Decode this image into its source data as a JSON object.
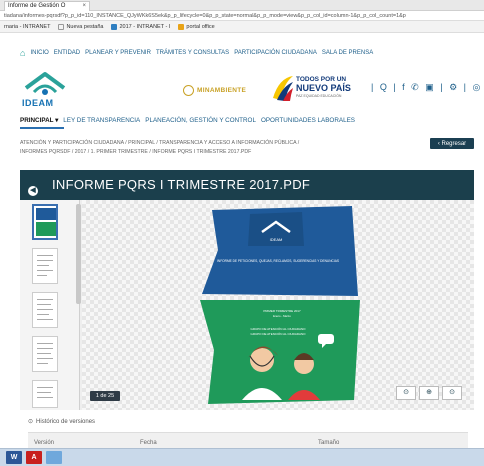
{
  "browser": {
    "tab_title": "Informe de Gestión O",
    "tab_close": "×",
    "url": "tiadana/informes-pqrsdf?p_p_id=110_INSTANCE_QJyWKk6S5ek&p_p_lifecycle=0&p_p_state=normal&p_p_mode=view&p_p_col_id=column-1&p_p_col_count=1&p",
    "bookmarks": [
      {
        "label": "rnaria - INTRANET",
        "color": "#ffffff"
      },
      {
        "label": "Nueva pestaña",
        "color": "#ffffff"
      },
      {
        "label": "2017 - INTRANET - I",
        "color": "#2f7fc1"
      },
      {
        "label": "portal office",
        "color": "#e8a317"
      }
    ]
  },
  "topnav": {
    "items": [
      "INICIO",
      "ENTIDAD",
      "PLANEAR Y PREVENIR",
      "TRÁMITES Y CONSULTAS",
      "PARTICIPACIÓN CIUDADANA",
      "SALA DE PRENSA"
    ]
  },
  "header": {
    "logo_text": "IDEAM",
    "minambiente": "MINAMBIENTE",
    "todos1": "TODOS POR UN",
    "todos2": "NUEVO PAÍS",
    "todos3": "PAZ  EQUIDAD  EDUCACIÓN",
    "social_icons": "| Q | f ✆ ▣ | ⚙ | ◎ ▾"
  },
  "mainnav": {
    "principal": "PRINCIPAL ▾",
    "items": [
      "LEY DE TRANSPARENCIA",
      "PLANEACIÓN, GESTIÓN Y CONTROL",
      "OPORTUNIDADES LABORALES"
    ]
  },
  "breadcrumb": {
    "line1": "ATENCIÓN Y PARTICIPACIÓN CIUDADANA  /  PRINCIPAL  /  TRANSPARENCIA Y ACCESO A INFORMACIÓN PÚBLICA  /",
    "line2": "INFORMES PQRSDF  /  2017  /  1. PRIMER TRIMESTRE  /  INFORME PQRS I TRIMESTRE 2017.PDF"
  },
  "regresar": "‹  Regresar",
  "viewer": {
    "title": "INFORME PQRS I TRIMESTRE 2017.PDF",
    "circle": "◀",
    "page_badge": "1 de 25",
    "controls": [
      "⊙",
      "⊕",
      "⊙"
    ],
    "page": {
      "brand": "IDEAM",
      "heading": "INFORME DE PETICIONES, QUEJAS, RECLAMOS, SUGERENCIAS Y DENUNCIAS",
      "period": "PRIMER TRIMESTRE 2017",
      "period_sub": "Enero - Marzo",
      "group1": "GRUPO DE ATENCIÓN AL CIUDADANO",
      "group2": "GRUPO DE ATENCIÓN AL CIUDADANO"
    }
  },
  "versions": {
    "title": "Histórico de versiones",
    "headers": [
      "Versión",
      "Fecha",
      "Tamaño"
    ]
  },
  "taskbar": [
    {
      "name": "word",
      "label": "W",
      "color": "#2b5797"
    },
    {
      "name": "acrobat",
      "label": "A",
      "color": "#c8201e"
    },
    {
      "name": "explorer",
      "label": "",
      "color": "#6fa8dc"
    }
  ],
  "colors": {
    "header_bg": "#1b3f4c",
    "page_blue": "#1f5a9a",
    "page_green": "#1f9a5a",
    "accent": "#2aa29a"
  }
}
